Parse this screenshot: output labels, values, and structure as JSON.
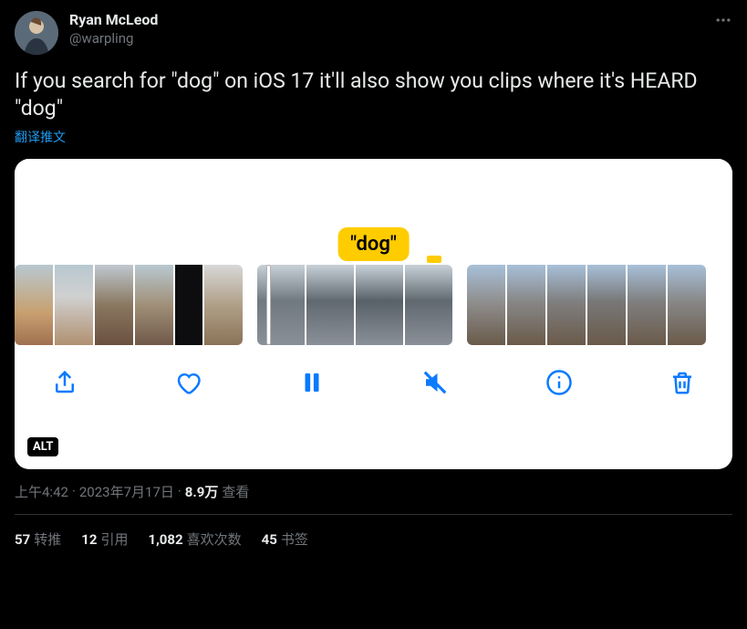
{
  "user": {
    "display_name": "Ryan McLeod",
    "handle": "@warpling"
  },
  "tweet": {
    "text": "If you search for \"dog\" on iOS 17 it'll also show you clips where it's HEARD \"dog\"",
    "translate_label": "翻译推文"
  },
  "media": {
    "search_token": "\"dog\"",
    "alt_badge": "ALT",
    "toolbar": {
      "share": "share",
      "like": "like",
      "pause": "pause",
      "mute": "mute",
      "info": "info",
      "trash": "trash"
    }
  },
  "meta": {
    "time": "上午4:42",
    "dot1": " · ",
    "date": "2023年7月17日",
    "dot2": " · ",
    "views_count": "8.9万",
    "views_label": " 查看"
  },
  "stats": {
    "retweets_count": "57",
    "retweets_label": "转推",
    "quotes_count": "12",
    "quotes_label": "引用",
    "likes_count": "1,082",
    "likes_label": "喜欢次数",
    "bookmarks_count": "45",
    "bookmarks_label": "书签"
  }
}
